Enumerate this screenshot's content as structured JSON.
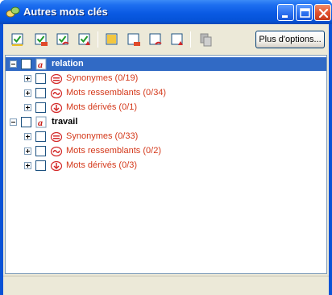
{
  "window": {
    "title": "Autres mots clés",
    "colors": {
      "title_bar": "#0553d8",
      "selection": "#316ac5",
      "child_label": "#d4381a"
    }
  },
  "toolbar": {
    "icons": [
      "check-all-icon",
      "check-synonyms-icon",
      "check-similar-icon",
      "check-derived-icon",
      "select-all-icon",
      "select-synonyms-icon",
      "select-similar-icon",
      "select-derived-icon",
      "copy-icon"
    ],
    "more_options_label": "Plus d'options..."
  },
  "tree": {
    "nodes": [
      {
        "label": "relation",
        "selected": true,
        "expanded": true,
        "children": [
          {
            "label": "Synonymes (0/19)",
            "icon": "synonyms-icon"
          },
          {
            "label": "Mots ressemblants (0/34)",
            "icon": "similar-words-icon"
          },
          {
            "label": "Mots dérivés (0/1)",
            "icon": "derived-words-icon"
          }
        ]
      },
      {
        "label": "travail",
        "selected": false,
        "expanded": true,
        "children": [
          {
            "label": "Synonymes (0/33)",
            "icon": "synonyms-icon"
          },
          {
            "label": "Mots ressemblants (0/2)",
            "icon": "similar-words-icon"
          },
          {
            "label": "Mots dérivés (0/3)",
            "icon": "derived-words-icon"
          }
        ]
      }
    ]
  }
}
